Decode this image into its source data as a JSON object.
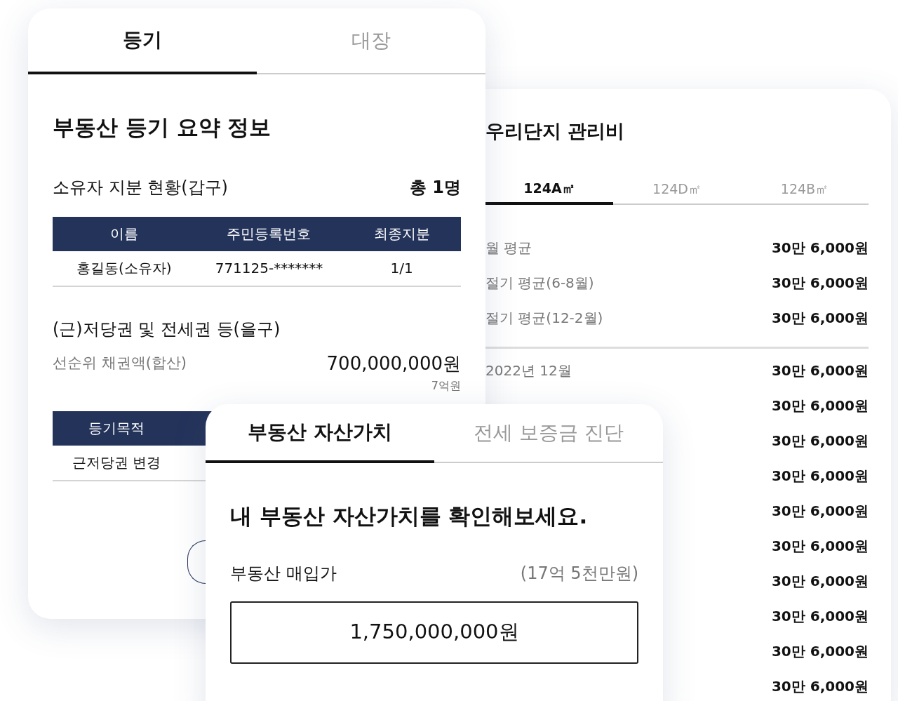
{
  "registry_card": {
    "tabs": [
      {
        "label": "등기",
        "selected": true
      },
      {
        "label": "대장",
        "selected": false
      }
    ],
    "title": "부동산 등기 요약 정보",
    "owners": {
      "heading": "소유자 지분 현황(갑구)",
      "count": "총 1명",
      "columns": [
        "이름",
        "주민등록번호",
        "최종지분"
      ],
      "rows": [
        [
          "홍길동(소유자)",
          "771125-*******",
          "1/1"
        ]
      ]
    },
    "liens": {
      "heading": "(근)저당권 및 전세권 등(을구)",
      "label": "선순위 채권액(합산)",
      "amount": "700,000,000원",
      "amount_short": "7억원"
    },
    "purpose_table": {
      "columns": [
        "등기목적"
      ],
      "rows": [
        [
          "근저당권 변경"
        ]
      ]
    }
  },
  "maintenance_card": {
    "title": "우리단지 관리비",
    "tabs": [
      {
        "label": "124A㎡",
        "selected": true
      },
      {
        "label": "124D㎡",
        "selected": false
      },
      {
        "label": "124B㎡",
        "selected": false
      }
    ],
    "summary_rows": [
      {
        "label": "월 평균",
        "value": "30만 6,000원"
      },
      {
        "label": "절기 평균(6-8월)",
        "value": "30만 6,000원"
      },
      {
        "label": "절기 평균(12-2월)",
        "value": "30만 6,000원"
      }
    ],
    "monthly_rows": [
      {
        "label": "2022년 12월",
        "value": "30만 6,000원"
      },
      {
        "value": "30만 6,000원"
      },
      {
        "value": "30만 6,000원"
      },
      {
        "value": "30만 6,000원"
      },
      {
        "value": "30만 6,000원"
      },
      {
        "value": "30만 6,000원"
      },
      {
        "value": "30만 6,000원"
      },
      {
        "value": "30만 6,000원"
      },
      {
        "value": "30만 6,000원"
      },
      {
        "value": "30만 6,000원"
      }
    ]
  },
  "asset_card": {
    "tabs": [
      {
        "label": "부동산 자산가치",
        "selected": true
      },
      {
        "label": "전세 보증금 진단",
        "selected": false
      }
    ],
    "heading": "내 부동산 자산가치를 확인해보세요.",
    "price_label": "부동산 매입가",
    "price_hint": "(17억 5천만원)",
    "price_value": "1,750,000,000원"
  }
}
